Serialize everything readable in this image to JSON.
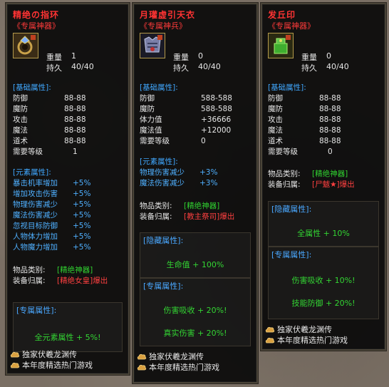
{
  "panel1": {
    "title": "精绝の指环",
    "subtitle": "《专属神器》",
    "icon": "ring-item-icon",
    "weight_label": "重量",
    "weight_value": "1",
    "durability_label": "持久",
    "durability_value": "40/40",
    "base_header": "[基础属性]:",
    "base_attrs": [
      {
        "label": "防御",
        "value": "88-88"
      },
      {
        "label": "魔防",
        "value": "88-88"
      },
      {
        "label": "攻击",
        "value": "88-88"
      },
      {
        "label": "魔法",
        "value": "88-88"
      },
      {
        "label": "道术",
        "value": "88-88"
      },
      {
        "label": "需要等级",
        "value": "1"
      }
    ],
    "element_header": "[元素属性]:",
    "element_attrs": [
      {
        "label": "暴击机率增加",
        "value": "+5%"
      },
      {
        "label": "增加攻击伤害",
        "value": "+5%"
      },
      {
        "label": "物理伤害减少",
        "value": "+5%"
      },
      {
        "label": "魔法伤害减少",
        "value": "+5%"
      },
      {
        "label": "忽视目标防御",
        "value": "+5%"
      },
      {
        "label": "人物体力增加",
        "value": "+5%"
      },
      {
        "label": "人物魔力增加",
        "value": "+5%"
      }
    ],
    "category_label": "物品类别:",
    "category_value": "[精绝神器]",
    "owner_label": "装备归属:",
    "owner_value": "[精绝女皇]爆出",
    "exclusive_header": "[专属属性]:",
    "exclusive_item": "全元素属性 + 5%!",
    "footer1": "独家伏羲龙渊传",
    "footer2": "本年度精选热门游戏"
  },
  "panel2": {
    "title": "月瓘虚引天衣",
    "subtitle": "《专属神兵》",
    "icon": "armor-item-icon",
    "weight_label": "重量",
    "weight_value": "0",
    "durability_label": "持久",
    "durability_value": "40/40",
    "base_header": "[基础属性]:",
    "base_attrs": [
      {
        "label": "防御",
        "value": "588-588"
      },
      {
        "label": "魔防",
        "value": "588-588"
      },
      {
        "label": "体力值",
        "value": "+36666"
      },
      {
        "label": "魔法值",
        "value": "+12000"
      },
      {
        "label": "需要等级",
        "value": "0"
      }
    ],
    "element_header": "[元素属性]:",
    "element_attrs": [
      {
        "label": "物理伤害减少",
        "value": "+3%"
      },
      {
        "label": "魔法伤害减少",
        "value": "+3%"
      }
    ],
    "category_label": "物品类别:",
    "category_value": "[精绝神器]",
    "owner_label": "装备归属:",
    "owner_value": "[教主祭司]爆出",
    "hidden_header": "[隐藏属性]:",
    "hidden_item": "生命值 + 100%",
    "exclusive_header": "[专属属性]:",
    "exclusive_items": [
      "伤害吸收 + 20%!",
      "真实伤害 + 20%!"
    ],
    "footer1": "独家伏羲龙渊传",
    "footer2": "本年度精选热门游戏"
  },
  "panel3": {
    "title": "发丘印",
    "subtitle": "《专属神器》",
    "icon": "seal-item-icon",
    "weight_label": "重量",
    "weight_value": "0",
    "durability_label": "持久",
    "durability_value": "40/40",
    "base_header": "[基础属性]:",
    "base_attrs": [
      {
        "label": "防御",
        "value": "88-88"
      },
      {
        "label": "魔防",
        "value": "88-88"
      },
      {
        "label": "攻击",
        "value": "88-88"
      },
      {
        "label": "魔法",
        "value": "88-88"
      },
      {
        "label": "道术",
        "value": "88-88"
      },
      {
        "label": "需要等级",
        "value": "0"
      }
    ],
    "category_label": "物品类别:",
    "category_value": "[精绝神器]",
    "owner_label": "装备归属:",
    "owner_value": "[尸魃★]爆出",
    "hidden_header": "[隐藏属性]:",
    "hidden_item": "全属性 + 10%",
    "exclusive_header": "[专属属性]:",
    "exclusive_items": [
      "伤害吸收 + 10%!",
      "技能防御 + 20%!"
    ],
    "footer1": "独家伏羲龙渊传",
    "footer2": "本年度精选热门游戏"
  },
  "colors": {
    "title_red": "#ff3333",
    "header_blue": "#40a8ff",
    "value_green": "#30d030",
    "text_white": "#e6e6e6"
  }
}
